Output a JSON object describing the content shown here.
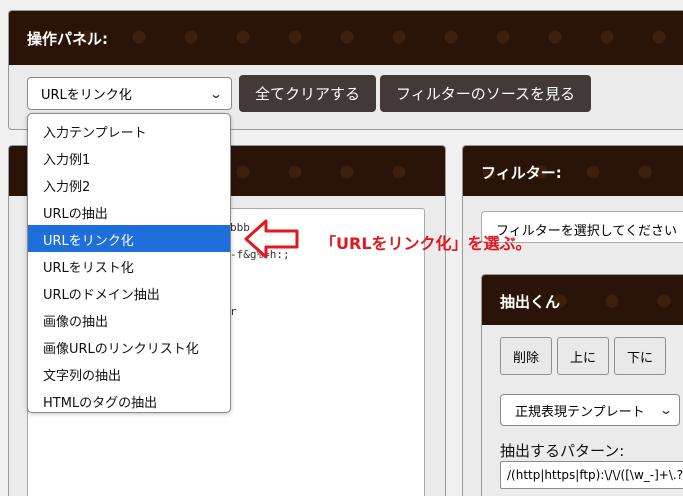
{
  "top_panel": {
    "title": "操作パネル:",
    "selected_option": "URLをリンク化",
    "clear_button": "全てクリアする",
    "view_source_button": "フィルターのソースを見る"
  },
  "dropdown": {
    "options": [
      "入力テンプレート",
      "入力例1",
      "入力例2",
      "URLの抽出",
      "URLをリンク化",
      "URLをリスト化",
      "URLのドメイン抽出",
      "画像の抽出",
      "画像URLのリンクリスト化",
      "文字列の抽出",
      "HTMLのタグの抽出"
    ],
    "selected": "URLをリンク化"
  },
  "input_area": {
    "lines": [
      "bbb",
      "-f&g%=h:;",
      "r"
    ]
  },
  "filter_panel": {
    "title": "フィルター:",
    "select_placeholder": "フィルターを選択してください"
  },
  "extract_panel": {
    "title": "抽出くん",
    "delete_button": "削除",
    "up_button": "上に",
    "down_button": "下に",
    "regex_template": "正規表現テンプレート",
    "pattern_label": "抽出するパターン:",
    "pattern_value": "/(http|https|ftp):\\/\\/([\\w_-]+\\.?)*"
  },
  "annotation": {
    "text": "「URLをリンク化」を選ぶ。",
    "color": "#e0181f"
  },
  "colors": {
    "panel_header": "#2a1307",
    "dark_button": "#413a38",
    "selection": "#1e6fd9"
  }
}
